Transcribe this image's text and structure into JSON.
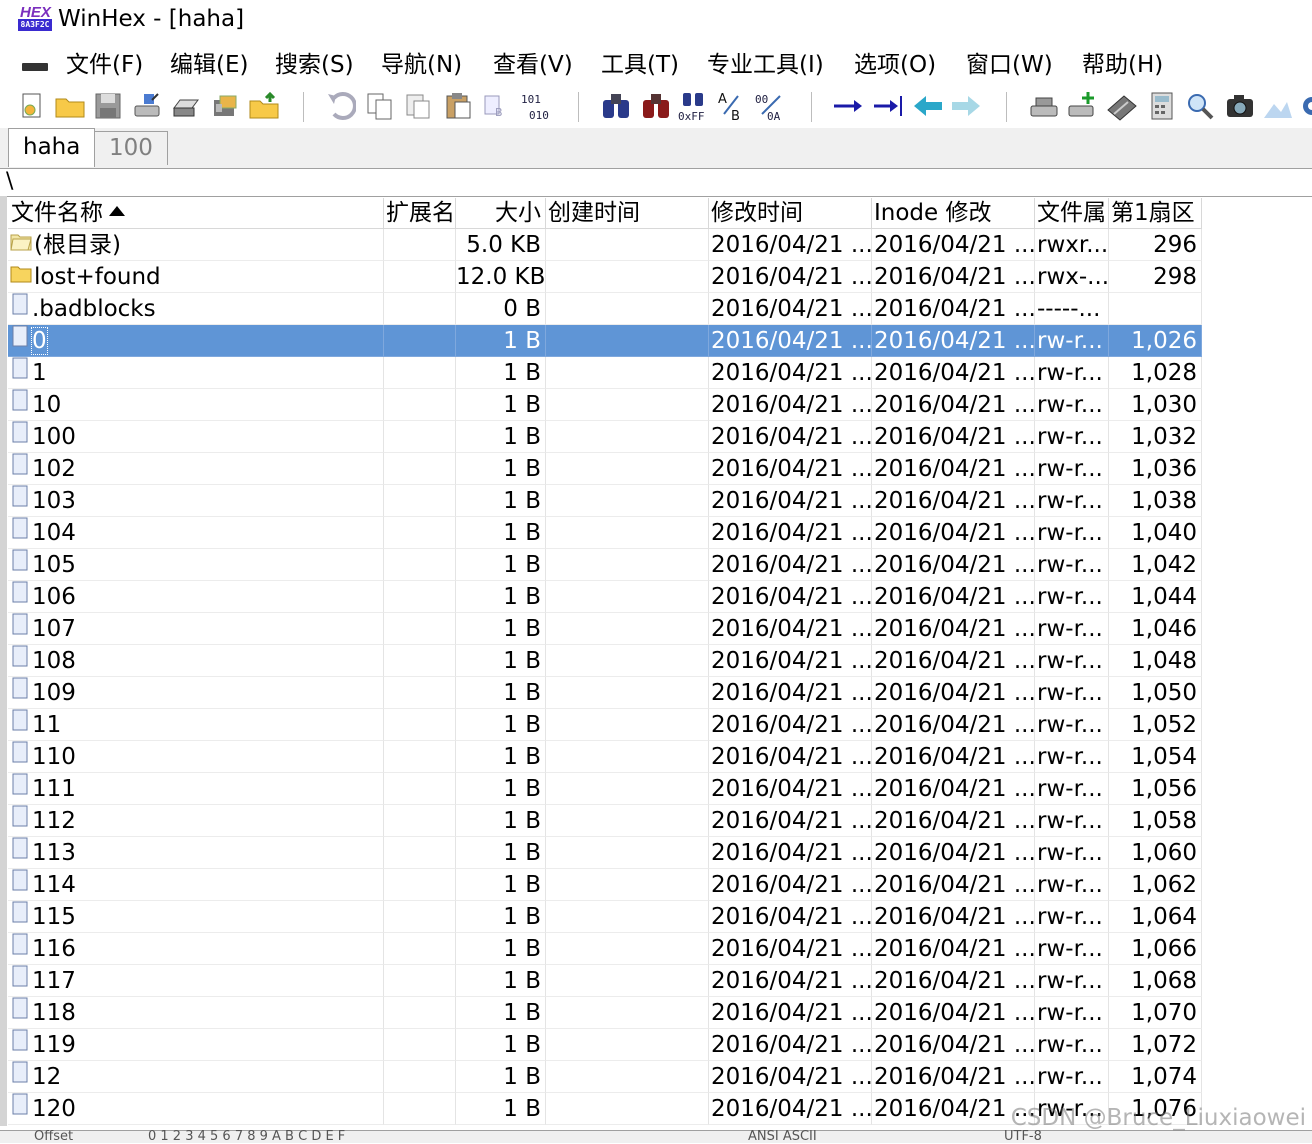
{
  "window": {
    "title": "WinHex - [haha]",
    "logo_top": "HEX",
    "logo_bottom": "8A3F2C"
  },
  "menu": [
    "文件(F)",
    "编辑(E)",
    "搜索(S)",
    "导航(N)",
    "查看(V)",
    "工具(T)",
    "专业工具(I)",
    "选项(O)",
    "窗口(W)",
    "帮助(H)"
  ],
  "toolbar": {
    "icons": [
      "new-file-icon",
      "open-folder-icon",
      "save-icon",
      "drive-icon",
      "printer-icon",
      "properties-icon",
      "up-folder-icon",
      "undo-icon",
      "copy-icon",
      "paste-icon",
      "clipboard-icon",
      "copy-hex-icon",
      "binary-icon",
      "find-icon",
      "find-text-icon",
      "find-hex-icon",
      "replace-text-icon",
      "replace-hex-icon",
      "goto-offset-icon",
      "goto-end-icon",
      "back-icon",
      "forward-icon",
      "open-disk-icon",
      "add-disk-icon",
      "ram-icon",
      "calculator-icon",
      "zoom-icon",
      "camera-icon",
      "chart-icon",
      "gear-icon"
    ]
  },
  "tabs": [
    "haha",
    "100"
  ],
  "path": "\\",
  "columns": {
    "name": "文件名称",
    "ext": "扩展名",
    "size": "大小",
    "created": "创建时间",
    "modified": "修改时间",
    "inode": "Inode 修改",
    "attr": "文件属",
    "sector": "第1扇区"
  },
  "rows": [
    {
      "icon": "folder-open",
      "name": "(根目录)",
      "size": "5.0 KB",
      "modified": "2016/04/21 ...",
      "inode": "2016/04/21 ...",
      "attr": "rwxr...",
      "sector": "296",
      "selected": false
    },
    {
      "icon": "folder",
      "name": "lost+found",
      "size": "12.0 KB",
      "modified": "2016/04/21 ...",
      "inode": "2016/04/21 ...",
      "attr": "rwx-...",
      "sector": "298",
      "selected": false
    },
    {
      "icon": "file",
      "name": ".badblocks",
      "size": "0 B",
      "modified": "2016/04/21 ...",
      "inode": "2016/04/21 ...",
      "attr": "-----...",
      "sector": "",
      "selected": false
    },
    {
      "icon": "file",
      "name": "0",
      "size": "1 B",
      "modified": "2016/04/21 ...",
      "inode": "2016/04/21 ...",
      "attr": "rw-r...",
      "sector": "1,026",
      "selected": true
    },
    {
      "icon": "file",
      "name": "1",
      "size": "1 B",
      "modified": "2016/04/21 ...",
      "inode": "2016/04/21 ...",
      "attr": "rw-r...",
      "sector": "1,028",
      "selected": false
    },
    {
      "icon": "file",
      "name": "10",
      "size": "1 B",
      "modified": "2016/04/21 ...",
      "inode": "2016/04/21 ...",
      "attr": "rw-r...",
      "sector": "1,030",
      "selected": false
    },
    {
      "icon": "file",
      "name": "100",
      "size": "1 B",
      "modified": "2016/04/21 ...",
      "inode": "2016/04/21 ...",
      "attr": "rw-r...",
      "sector": "1,032",
      "selected": false
    },
    {
      "icon": "file",
      "name": "102",
      "size": "1 B",
      "modified": "2016/04/21 ...",
      "inode": "2016/04/21 ...",
      "attr": "rw-r...",
      "sector": "1,036",
      "selected": false
    },
    {
      "icon": "file",
      "name": "103",
      "size": "1 B",
      "modified": "2016/04/21 ...",
      "inode": "2016/04/21 ...",
      "attr": "rw-r...",
      "sector": "1,038",
      "selected": false
    },
    {
      "icon": "file",
      "name": "104",
      "size": "1 B",
      "modified": "2016/04/21 ...",
      "inode": "2016/04/21 ...",
      "attr": "rw-r...",
      "sector": "1,040",
      "selected": false
    },
    {
      "icon": "file",
      "name": "105",
      "size": "1 B",
      "modified": "2016/04/21 ...",
      "inode": "2016/04/21 ...",
      "attr": "rw-r...",
      "sector": "1,042",
      "selected": false
    },
    {
      "icon": "file",
      "name": "106",
      "size": "1 B",
      "modified": "2016/04/21 ...",
      "inode": "2016/04/21 ...",
      "attr": "rw-r...",
      "sector": "1,044",
      "selected": false
    },
    {
      "icon": "file",
      "name": "107",
      "size": "1 B",
      "modified": "2016/04/21 ...",
      "inode": "2016/04/21 ...",
      "attr": "rw-r...",
      "sector": "1,046",
      "selected": false
    },
    {
      "icon": "file",
      "name": "108",
      "size": "1 B",
      "modified": "2016/04/21 ...",
      "inode": "2016/04/21 ...",
      "attr": "rw-r...",
      "sector": "1,048",
      "selected": false
    },
    {
      "icon": "file",
      "name": "109",
      "size": "1 B",
      "modified": "2016/04/21 ...",
      "inode": "2016/04/21 ...",
      "attr": "rw-r...",
      "sector": "1,050",
      "selected": false
    },
    {
      "icon": "file",
      "name": "11",
      "size": "1 B",
      "modified": "2016/04/21 ...",
      "inode": "2016/04/21 ...",
      "attr": "rw-r...",
      "sector": "1,052",
      "selected": false
    },
    {
      "icon": "file",
      "name": "110",
      "size": "1 B",
      "modified": "2016/04/21 ...",
      "inode": "2016/04/21 ...",
      "attr": "rw-r...",
      "sector": "1,054",
      "selected": false
    },
    {
      "icon": "file",
      "name": "111",
      "size": "1 B",
      "modified": "2016/04/21 ...",
      "inode": "2016/04/21 ...",
      "attr": "rw-r...",
      "sector": "1,056",
      "selected": false
    },
    {
      "icon": "file",
      "name": "112",
      "size": "1 B",
      "modified": "2016/04/21 ...",
      "inode": "2016/04/21 ...",
      "attr": "rw-r...",
      "sector": "1,058",
      "selected": false
    },
    {
      "icon": "file",
      "name": "113",
      "size": "1 B",
      "modified": "2016/04/21 ...",
      "inode": "2016/04/21 ...",
      "attr": "rw-r...",
      "sector": "1,060",
      "selected": false
    },
    {
      "icon": "file",
      "name": "114",
      "size": "1 B",
      "modified": "2016/04/21 ...",
      "inode": "2016/04/21 ...",
      "attr": "rw-r...",
      "sector": "1,062",
      "selected": false
    },
    {
      "icon": "file",
      "name": "115",
      "size": "1 B",
      "modified": "2016/04/21 ...",
      "inode": "2016/04/21 ...",
      "attr": "rw-r...",
      "sector": "1,064",
      "selected": false
    },
    {
      "icon": "file",
      "name": "116",
      "size": "1 B",
      "modified": "2016/04/21 ...",
      "inode": "2016/04/21 ...",
      "attr": "rw-r...",
      "sector": "1,066",
      "selected": false
    },
    {
      "icon": "file",
      "name": "117",
      "size": "1 B",
      "modified": "2016/04/21 ...",
      "inode": "2016/04/21 ...",
      "attr": "rw-r...",
      "sector": "1,068",
      "selected": false
    },
    {
      "icon": "file",
      "name": "118",
      "size": "1 B",
      "modified": "2016/04/21 ...",
      "inode": "2016/04/21 ...",
      "attr": "rw-r...",
      "sector": "1,070",
      "selected": false
    },
    {
      "icon": "file",
      "name": "119",
      "size": "1 B",
      "modified": "2016/04/21 ...",
      "inode": "2016/04/21 ...",
      "attr": "rw-r...",
      "sector": "1,072",
      "selected": false
    },
    {
      "icon": "file",
      "name": "12",
      "size": "1 B",
      "modified": "2016/04/21 ...",
      "inode": "2016/04/21 ...",
      "attr": "rw-r...",
      "sector": "1,074",
      "selected": false
    },
    {
      "icon": "file",
      "name": "120",
      "size": "1 B",
      "modified": "2016/04/21 ...",
      "inode": "2016/04/21 ...",
      "attr": "rw-r...",
      "sector": "1,076",
      "selected": false
    }
  ],
  "statusbar": {
    "offset_label": "Offset",
    "hex_columns": "0  1  2  3  4  5  6  7   8  9  A  B  C  D  E  F",
    "charset": "ANSI ASCII",
    "encoding": "UTF-8"
  },
  "watermark": "CSDN @Bruce_Liuxiaowei",
  "colors": {
    "selection": "#5f95d6",
    "tab_strip": "#f0f0f0",
    "arrow_blue": "#1a1aa8",
    "nav_teal": "#2aa7c9"
  }
}
